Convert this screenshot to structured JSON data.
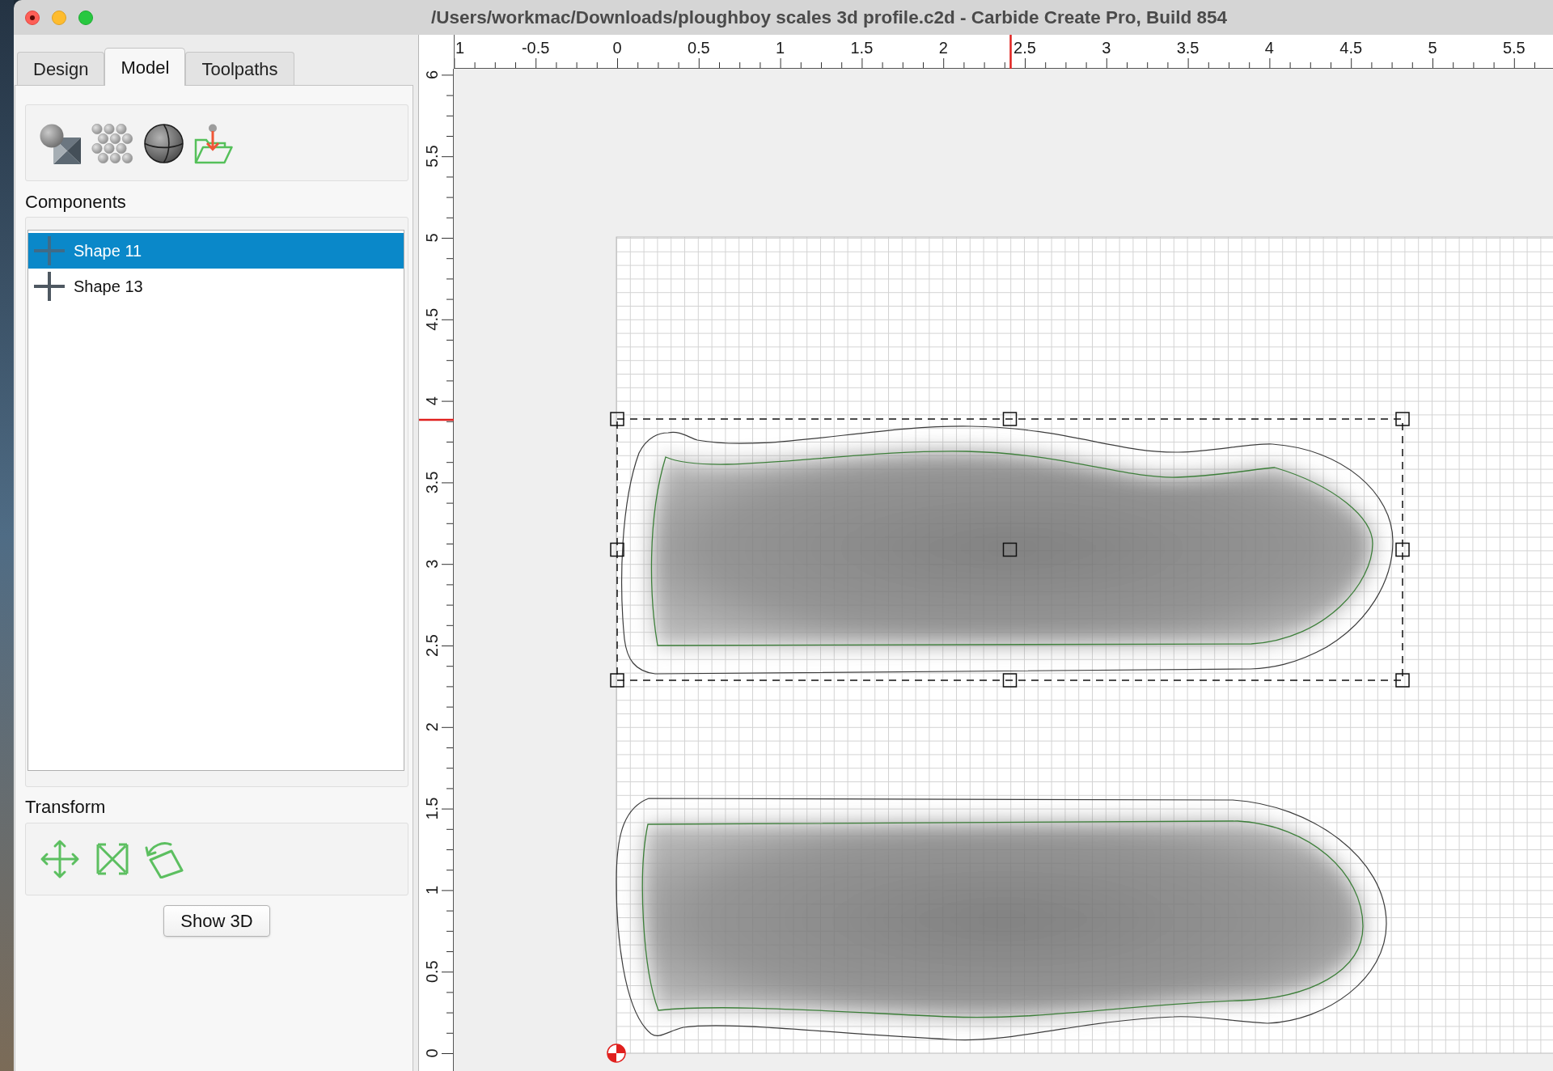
{
  "window": {
    "title": "/Users/workmac/Downloads/ploughboy scales 3d profile.c2d - Carbide Create Pro, Build 854"
  },
  "tabs": [
    {
      "label": "Design",
      "selected": false
    },
    {
      "label": "Model",
      "selected": true
    },
    {
      "label": "Toolpaths",
      "selected": false
    }
  ],
  "components": {
    "label": "Components",
    "items": [
      {
        "name": "Shape 11",
        "selected": true
      },
      {
        "name": "Shape 13",
        "selected": false
      }
    ]
  },
  "transform": {
    "label": "Transform"
  },
  "show_3d_button": {
    "label": "Show 3D"
  },
  "horizontal_ruler": {
    "labels": [
      "1",
      "-0.5",
      "0",
      "0.5",
      "1",
      "1.5",
      "2",
      "2.5",
      "3",
      "3.5",
      "4",
      "4.5",
      "5",
      "5.5"
    ]
  },
  "vertical_ruler": {
    "labels": [
      "6",
      "5.5",
      "5",
      "4.5",
      "4",
      "3.5",
      "3",
      "2.5",
      "2",
      "1.5",
      "1",
      "0.5",
      "0"
    ]
  }
}
